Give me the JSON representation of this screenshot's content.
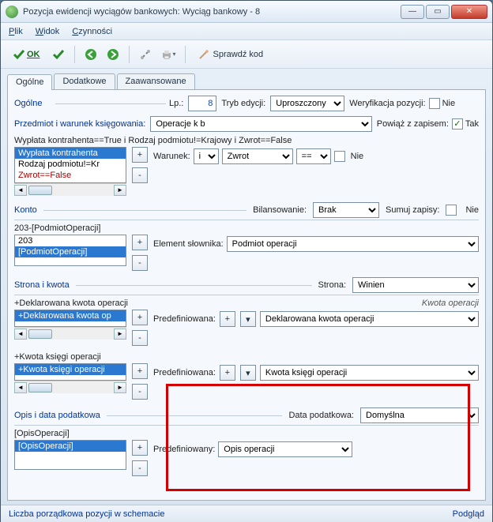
{
  "window": {
    "title": "Pozycja ewidencji wyciągów bankowych: Wyciąg bankowy - 8"
  },
  "menubar": {
    "plik": "Plik",
    "widok": "Widok",
    "czynnosci": "Czynności"
  },
  "toolbar": {
    "ok": "OK",
    "sprawdz": "Sprawdź kod"
  },
  "tabs": {
    "ogolne": "Ogólne",
    "dodatkowe": "Dodatkowe",
    "zaaw": "Zaawansowane"
  },
  "ogolne": {
    "legend": "Ogólne",
    "lp_label": "Lp.:",
    "lp_value": "8",
    "tryb_label": "Tryb edycji:",
    "tryb_value": "Uproszczony",
    "weryf_label": "Weryfikacja pozycji:",
    "weryf_value": "Nie",
    "przedmiot_label": "Przedmiot i warunek księgowania:",
    "przedmiot_value": "Operacje k b",
    "powiaz_label": "Powiąż z zapisem:",
    "powiaz_value": "Tak"
  },
  "warunek": {
    "caption": "Wypłata kontrahenta==True i Rodzaj podmiotu!=Krajowy i Zwrot==False",
    "items": [
      "Wypłata kontrahenta",
      "Rodzaj podmiotu!=Kr",
      "Zwrot==False"
    ],
    "label": "Warunek:",
    "op1": "i",
    "field": "Zwrot",
    "cmp": "==",
    "chk": "Nie"
  },
  "konto": {
    "legend": "Konto",
    "bil_label": "Bilansowanie:",
    "bil_value": "Brak",
    "sum_label": "Sumuj zapisy:",
    "sum_value": "Nie",
    "sub": "203-[PodmiotOperacji]",
    "items": [
      "203",
      "[PodmiotOperacji]"
    ],
    "elem_label": "Element słownika:",
    "elem_value": "Podmiot operacji"
  },
  "strona": {
    "legend": "Strona i kwota",
    "strona_label": "Strona:",
    "strona_value": "Winien",
    "kwota_operacji_label": "Kwota operacji",
    "dk_header": "+Deklarowana kwota operacji",
    "dk_item": "+Deklarowana kwota op",
    "predef_label": "Predefiniowana:",
    "predef_val1": "Deklarowana kwota operacji",
    "kk_header": "+Kwota księgi operacji",
    "kk_item": "+Kwota księgi operacji",
    "predef_val2": "Kwota księgi operacji"
  },
  "opis": {
    "legend": "Opis i data podatkowa",
    "data_label": "Data podatkowa:",
    "data_value": "Domyślna",
    "sub": "[OpisOperacji]",
    "item": "[OpisOperacji]",
    "predef_label": "Predefiniowany:",
    "predef_value": "Opis operacji"
  },
  "status": {
    "left": "Liczba porządkowa pozycji w schemacie",
    "right": "Podgląd"
  }
}
